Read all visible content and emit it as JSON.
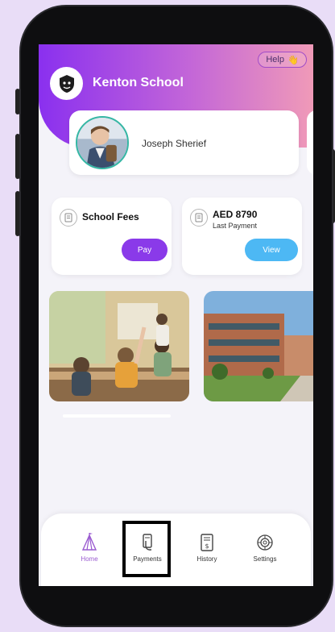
{
  "header": {
    "school_name": "Kenton School",
    "help_label": "Help",
    "help_emoji": "👋"
  },
  "student": {
    "name": "Joseph Sherief"
  },
  "fees_card": {
    "title": "School Fees",
    "button": "Pay"
  },
  "payment_card": {
    "amount": "AED 8790",
    "subtitle": "Last Payment",
    "button": "View"
  },
  "nav": {
    "items": [
      {
        "label": "Home",
        "icon": "tent-icon",
        "active": true
      },
      {
        "label": "Payments",
        "icon": "phone-card-icon",
        "active": false
      },
      {
        "label": "History",
        "icon": "receipt-icon",
        "active": false
      },
      {
        "label": "Settings",
        "icon": "gear-icon",
        "active": false
      }
    ]
  },
  "colors": {
    "accent": "#8a3ae9",
    "view_button": "#4db8f4",
    "avatar_ring": "#35b7a4"
  }
}
